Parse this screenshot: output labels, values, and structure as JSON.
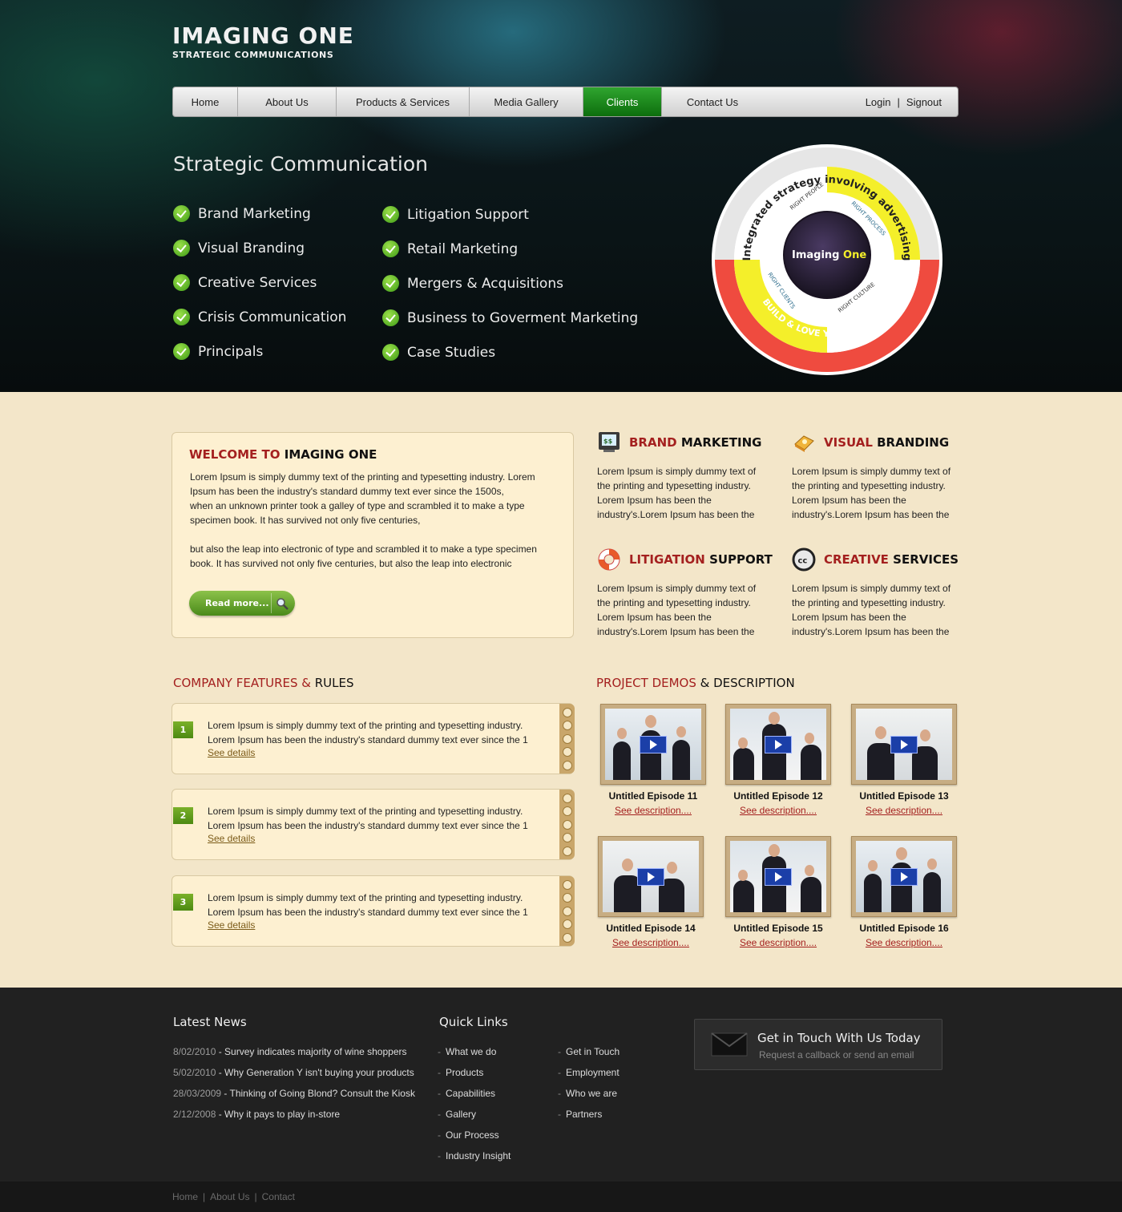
{
  "logo": {
    "main": "IMAGING ONE",
    "sub": "STRATEGIC COMMUNICATIONS"
  },
  "nav": {
    "items": [
      "Home",
      "About Us",
      "Products & Services",
      "Media Gallery",
      "Clients",
      "Contact Us"
    ],
    "active": "Clients",
    "login": "Login",
    "separator": "|",
    "signout": "Signout"
  },
  "hero": {
    "title": "Strategic Communication",
    "services_left": [
      "Brand Marketing",
      "Visual Branding",
      "Creative Services",
      "Crisis Communication",
      "Principals"
    ],
    "services_right": [
      "Litigation Support",
      "Retail Marketing",
      "Mergers & Acquisitions",
      "Business to Goverment Marketing",
      "Case Studies"
    ],
    "wheel": {
      "outer_top": "Integrated strategy involving advertising",
      "outer_bottom": "BUILD & LOVE YOUR NETWORK",
      "segments": [
        "RIGHT PEOPLE",
        "RIGHT PROCESS",
        "RIGHT CULTURE",
        "RIGHT CLIENTS"
      ],
      "center_a": "Imaging",
      "center_b": "One"
    }
  },
  "welcome": {
    "title_a": "WELCOME TO",
    "title_b": "IMAGING ONE",
    "para1_lines": [
      "Lorem Ipsum is simply dummy text of the printing and typesetting industry. Lorem",
      "Ipsum has been the industry's standard dummy text ever since the 1500s,",
      "when an unknown printer took a galley of type and scrambled it to make a type",
      "specimen book. It has survived not only five centuries,"
    ],
    "para2_lines": [
      "but also the leap into electronic of type and scrambled it to make a type specimen",
      "book. It has survived not only five centuries, but also the leap into electronic"
    ],
    "read_more": "Read more..."
  },
  "features": [
    {
      "title_a": "BRAND",
      "title_b": "MARKETING",
      "icon": "money-monitor-icon",
      "lines": [
        "Lorem Ipsum is simply dummy text of",
        "the printing and typesetting industry.",
        "Lorem Ipsum has been the",
        "industry's.Lorem Ipsum has been the"
      ]
    },
    {
      "title_a": "VISUAL",
      "title_b": "BRANDING",
      "icon": "book-icon",
      "lines": [
        "Lorem Ipsum is simply dummy text of",
        "the printing and typesetting industry.",
        "Lorem Ipsum has been the",
        "industry's.Lorem Ipsum has been the"
      ]
    },
    {
      "title_a": "LITIGATION",
      "title_b": "SUPPORT",
      "icon": "lifebuoy-icon",
      "lines": [
        "Lorem Ipsum is simply dummy text of",
        "the printing and typesetting industry.",
        "Lorem Ipsum has been the",
        "industry's.Lorem Ipsum has been the"
      ]
    },
    {
      "title_a": "CREATIVE",
      "title_b": "SERVICES",
      "icon": "creative-commons-icon",
      "lines": [
        "Lorem Ipsum is simply dummy text of",
        "the printing and typesetting industry.",
        "Lorem Ipsum has been the",
        "industry's.Lorem Ipsum has been the"
      ]
    }
  ],
  "company": {
    "title_a": "COMPANY FEATURES &",
    "title_b": "RULES",
    "rules": [
      {
        "num": "1",
        "line1": "Lorem Ipsum is simply dummy text of the printing and typesetting industry.",
        "line2": "Lorem Ipsum has been the industry's standard dummy text ever since the 1",
        "link": "See details"
      },
      {
        "num": "2",
        "line1": "Lorem Ipsum is simply dummy text of the printing and typesetting industry.",
        "line2": "Lorem Ipsum has been the industry's standard dummy text ever since the 1",
        "link": "See details"
      },
      {
        "num": "3",
        "line1": "Lorem Ipsum is simply dummy text of the printing and typesetting industry.",
        "line2": "Lorem Ipsum has been the industry's standard dummy text ever since the 1",
        "link": "See details"
      }
    ]
  },
  "demos": {
    "title_a": "PROJECT DEMOS",
    "title_b": "& DESCRIPTION",
    "items": [
      {
        "title": "Untitled Episode 11",
        "link": "See description....",
        "scene": "standing-group"
      },
      {
        "title": "Untitled Episode 12",
        "link": "See description....",
        "scene": "meeting-table"
      },
      {
        "title": "Untitled Episode 13",
        "link": "See description....",
        "scene": "desk-pair"
      },
      {
        "title": "Untitled Episode 14",
        "link": "See description....",
        "scene": "desk-pair"
      },
      {
        "title": "Untitled Episode 15",
        "link": "See description....",
        "scene": "meeting-table"
      },
      {
        "title": "Untitled Episode 16",
        "link": "See description....",
        "scene": "standing-group"
      }
    ]
  },
  "footer": {
    "news_title": "Latest News",
    "news": [
      {
        "date": "8/02/2010",
        "text": " - Survey indicates majority of wine shoppers"
      },
      {
        "date": "5/02/2010",
        "text": " - Why Generation Y isn't buying your products"
      },
      {
        "date": "28/03/2009",
        "text": " - Thinking of Going Blond? Consult the Kiosk"
      },
      {
        "date": "2/12/2008",
        "text": " - Why it pays to play in-store"
      }
    ],
    "quick_title": "Quick Links",
    "quick_col1": [
      "What we do",
      "Products",
      "Capabilities",
      "Gallery",
      "Our Process",
      "Industry Insight"
    ],
    "quick_col2": [
      "Get in Touch",
      "Employment",
      "Who we are",
      "Partners"
    ],
    "contact_title": "Get in Touch With Us Today",
    "contact_sub": "Request a callback or send an email",
    "bottom_links": [
      "Home",
      "About Us",
      "Contact"
    ]
  },
  "colors": {
    "accent_red": "#a4201f",
    "active_green": "#0d6e0d",
    "page_bg": "#f3e6c9",
    "footer_bg": "#212121"
  }
}
